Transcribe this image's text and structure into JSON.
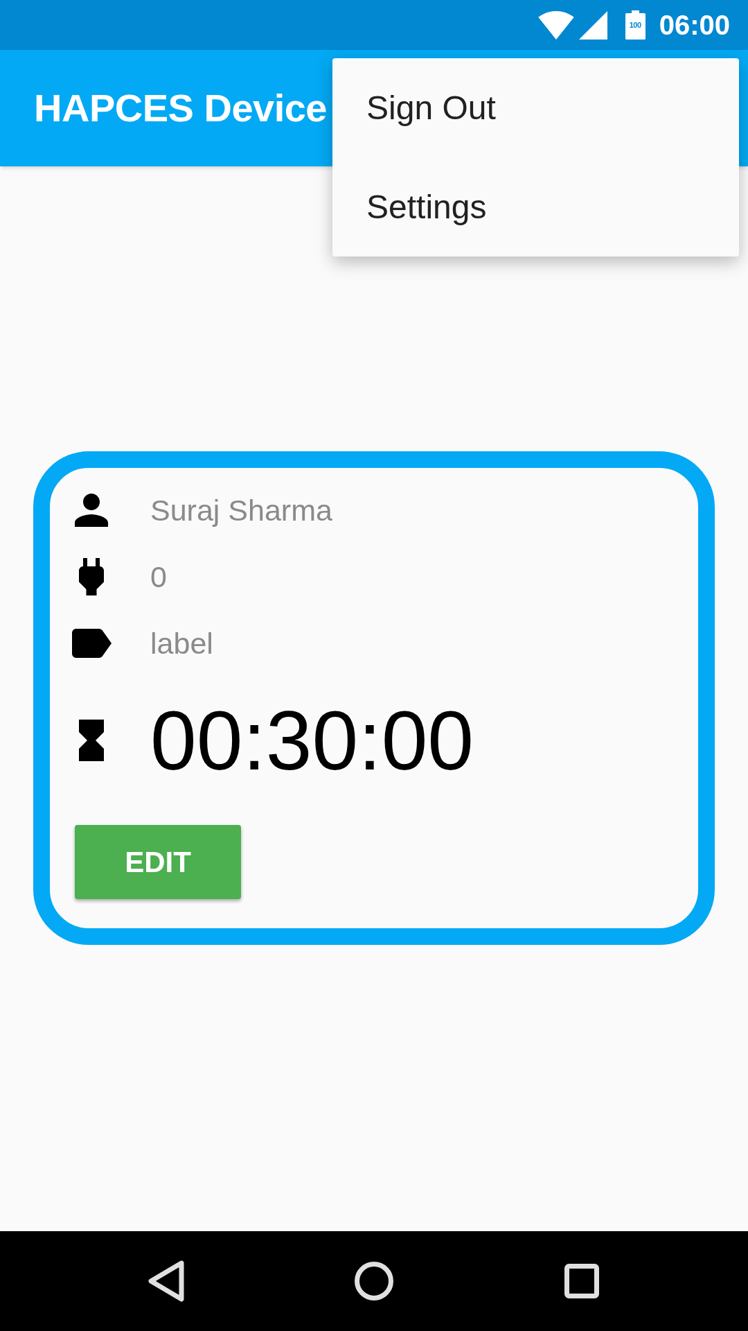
{
  "status_bar": {
    "battery_text": "100",
    "time": "06:00"
  },
  "app_bar": {
    "title": "HAPCES Device"
  },
  "overflow_menu": {
    "items": [
      {
        "label": "Sign Out"
      },
      {
        "label": "Settings"
      }
    ]
  },
  "device_card": {
    "rows": [
      {
        "kind": "person",
        "text": "Suraj Sharma"
      },
      {
        "kind": "plug",
        "text": "0"
      },
      {
        "kind": "tag",
        "text": "label"
      },
      {
        "kind": "timer",
        "text": "00:30:00"
      }
    ],
    "button": {
      "label": "EDIT"
    }
  }
}
